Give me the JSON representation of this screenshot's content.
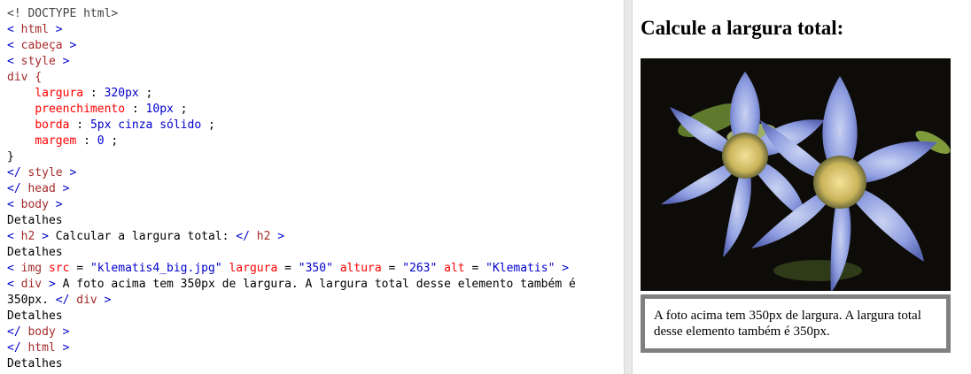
{
  "code": {
    "doctype": "<! DOCTYPE html>",
    "html_open": "html",
    "head_open": "cabeça",
    "style_open": "style",
    "selector": "div {",
    "rules": [
      {
        "prop": "largura",
        "val": "320px"
      },
      {
        "prop": "preenchimento",
        "val": "10px"
      },
      {
        "prop": "borda",
        "val": "5px cinza sólido"
      },
      {
        "prop": "margem",
        "val": "0"
      }
    ],
    "close_brace": "}",
    "style_close": "style",
    "head_close": "head",
    "body_open": "body",
    "detalhes": "Detalhes",
    "h2_tag": "h2",
    "h2_text": "Calcular a largura total:",
    "img_tag": "img",
    "img_attrs": [
      {
        "name": "src",
        "value": "\"klematis4_big.jpg\""
      },
      {
        "name": "largura",
        "value": "\"350\""
      },
      {
        "name": "altura",
        "value": "\"263\""
      },
      {
        "name": "alt",
        "value": "\"Klematis\""
      }
    ],
    "div_tag": "div",
    "div_text": "A foto acima tem 350px de largura. A largura total desse elemento também é 350px.",
    "body_close": "body",
    "html_close": "html"
  },
  "preview": {
    "heading": "Calcule a largura total:",
    "caption": "A foto acima tem 350px de largura. A largura total desse elemento também é 350px."
  }
}
